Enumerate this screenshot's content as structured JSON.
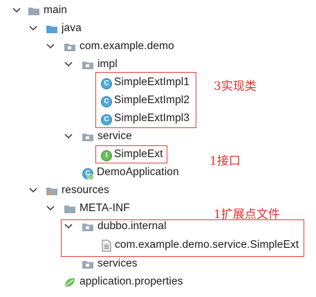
{
  "tree": {
    "main": "main",
    "java": "java",
    "package": "com.example.demo",
    "impl": "impl",
    "impl_classes": [
      "SimpleExtImpl1",
      "SimpleExtImpl2",
      "SimpleExtImpl3"
    ],
    "service": "service",
    "interface": "SimpleExt",
    "app": "DemoApplication",
    "resources": "resources",
    "metainf": "META-INF",
    "dubbo_internal": "dubbo.internal",
    "spi_file": "com.example.demo.service.SimpleExt",
    "services": "services",
    "properties": "application.properties"
  },
  "annotations": {
    "impl": "3实现类",
    "iface": "1接口",
    "ext_file": "1扩展点文件"
  },
  "colors": {
    "folder": "#8a9aa8",
    "source_folder": "#5aa0d8",
    "annotation": "#e0302c",
    "class_icon": "#4fa9d8",
    "interface_icon": "#6cbf5a"
  }
}
